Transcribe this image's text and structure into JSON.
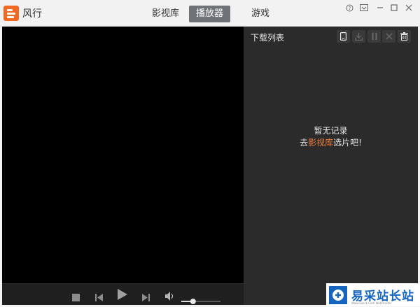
{
  "app": {
    "name": "风行",
    "brand_color": "#f06a24"
  },
  "tabs": [
    {
      "label": "影视库",
      "active": false
    },
    {
      "label": "播放器",
      "active": true
    },
    {
      "label": "游戏",
      "active": false
    }
  ],
  "window_controls": [
    "help-icon",
    "dropdown-icon",
    "minimize-icon",
    "maximize-icon",
    "close-icon"
  ],
  "player": {
    "controls": [
      "stop-icon",
      "previous-icon",
      "play-icon",
      "next-icon",
      "volume-icon"
    ],
    "volume_level": 0.3
  },
  "download_panel": {
    "title": "下载列表",
    "toolbar": [
      "phone-icon",
      "download-icon",
      "pause-icon",
      "cancel-icon",
      "trash-icon"
    ],
    "empty_title": "暂无记录",
    "hint_prefix": "去",
    "hint_link": "影视库",
    "hint_suffix": "选片吧!",
    "link_color": "#f07a3a"
  },
  "watermark": {
    "text": "易采站长站",
    "sub": "Www.Easck.Com  Webmaster"
  }
}
